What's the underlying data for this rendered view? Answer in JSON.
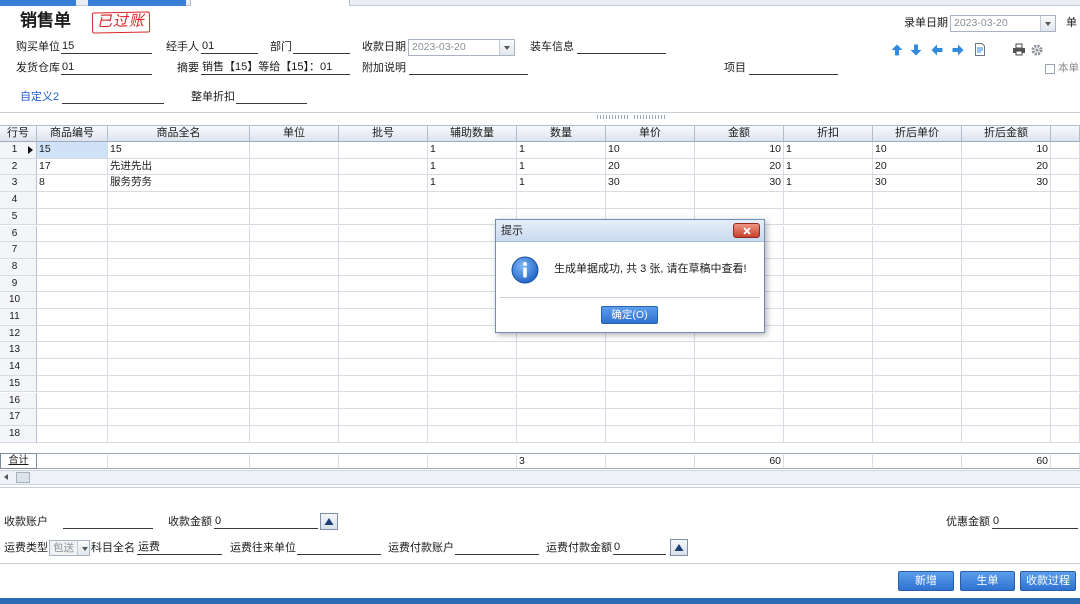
{
  "title": "销售单",
  "status_stamp": "已过账",
  "colors": {
    "accent": "#3a7fd6",
    "stamp_red": "#d9262a",
    "custom_label_blue": "#1d5fd1",
    "selected_cell": "#cfe2f7"
  },
  "header": {
    "entry_date": {
      "label": "录单日期",
      "value": "2023-03-20"
    },
    "doc_no_label": "单",
    "buyer": {
      "label": "购买单位",
      "value": "15"
    },
    "handler": {
      "label": "经手人",
      "value": "01"
    },
    "department": {
      "label": "部门",
      "value": ""
    },
    "receipt_date": {
      "label": "收款日期",
      "value": "2023-03-20"
    },
    "loading_info": {
      "label": "装车信息",
      "value": ""
    },
    "warehouse": {
      "label": "发货仓库",
      "value": "01"
    },
    "summary": {
      "label": "摘要",
      "value": "销售【15】等给【15】：01"
    },
    "note": {
      "label": "附加说明",
      "value": ""
    },
    "project": {
      "label": "项目",
      "value": ""
    },
    "this_doc": {
      "label": "本单",
      "checked": false
    },
    "custom2": {
      "label": "自定义2",
      "value": ""
    },
    "whole_discount": {
      "label": "整单折扣",
      "value": ""
    }
  },
  "toolbar_icons": [
    "arrow-up-icon",
    "arrow-down-icon",
    "arrow-left-icon",
    "arrow-right-icon",
    "document-icon",
    "printer-icon",
    "gear-icon"
  ],
  "table": {
    "columns": [
      "行号",
      "商品编号",
      "商品全名",
      "单位",
      "批号",
      "辅助数量",
      "数量",
      "单价",
      "金额",
      "折扣",
      "折后单价",
      "折后金额",
      ""
    ],
    "current_row": 1,
    "rows": [
      {
        "no": "1",
        "code": "15",
        "name": "15",
        "unit": "",
        "batch": "",
        "aux_qty": "1",
        "qty": "1",
        "price": "10",
        "amount": "10",
        "discount": "1",
        "disc_price": "10",
        "disc_amount": "10"
      },
      {
        "no": "2",
        "code": "17",
        "name": "先进先出",
        "unit": "",
        "batch": "",
        "aux_qty": "1",
        "qty": "1",
        "price": "20",
        "amount": "20",
        "discount": "1",
        "disc_price": "20",
        "disc_amount": "20"
      },
      {
        "no": "3",
        "code": "8",
        "name": "服务劳务",
        "unit": "",
        "batch": "",
        "aux_qty": "1",
        "qty": "1",
        "price": "30",
        "amount": "30",
        "discount": "1",
        "disc_price": "30",
        "disc_amount": "30"
      },
      {
        "no": "4"
      },
      {
        "no": "5"
      },
      {
        "no": "6"
      },
      {
        "no": "7"
      },
      {
        "no": "8"
      },
      {
        "no": "9"
      },
      {
        "no": "10"
      },
      {
        "no": "11"
      },
      {
        "no": "12"
      },
      {
        "no": "13"
      },
      {
        "no": "14"
      },
      {
        "no": "15"
      },
      {
        "no": "16"
      },
      {
        "no": "17"
      },
      {
        "no": "18"
      }
    ],
    "total": {
      "label": "合计",
      "qty": "3",
      "amount": "60",
      "disc_amount": "60"
    }
  },
  "footer": {
    "account": {
      "label": "收款账户",
      "value": ""
    },
    "receipt_amount": {
      "label": "收款金额",
      "value": "0"
    },
    "discount_amount": {
      "label": "优惠金额",
      "value": "0"
    },
    "freight_type": {
      "label": "运费类型",
      "value": "包送"
    },
    "subject_name": {
      "label": "科目全名",
      "value": "运费"
    },
    "freight_party": {
      "label": "运费往来单位",
      "value": ""
    },
    "freight_account": {
      "label": "运费付款账户",
      "value": ""
    },
    "freight_amount": {
      "label": "运费付款金额",
      "value": "0"
    },
    "buttons": {
      "new": "新增",
      "generate": "生单",
      "receipt_process": "收款过程"
    }
  },
  "dialog": {
    "title": "提示",
    "message": "生成单据成功, 共 3 张, 请在草稿中查看!",
    "ok_label": "确定(O)"
  }
}
